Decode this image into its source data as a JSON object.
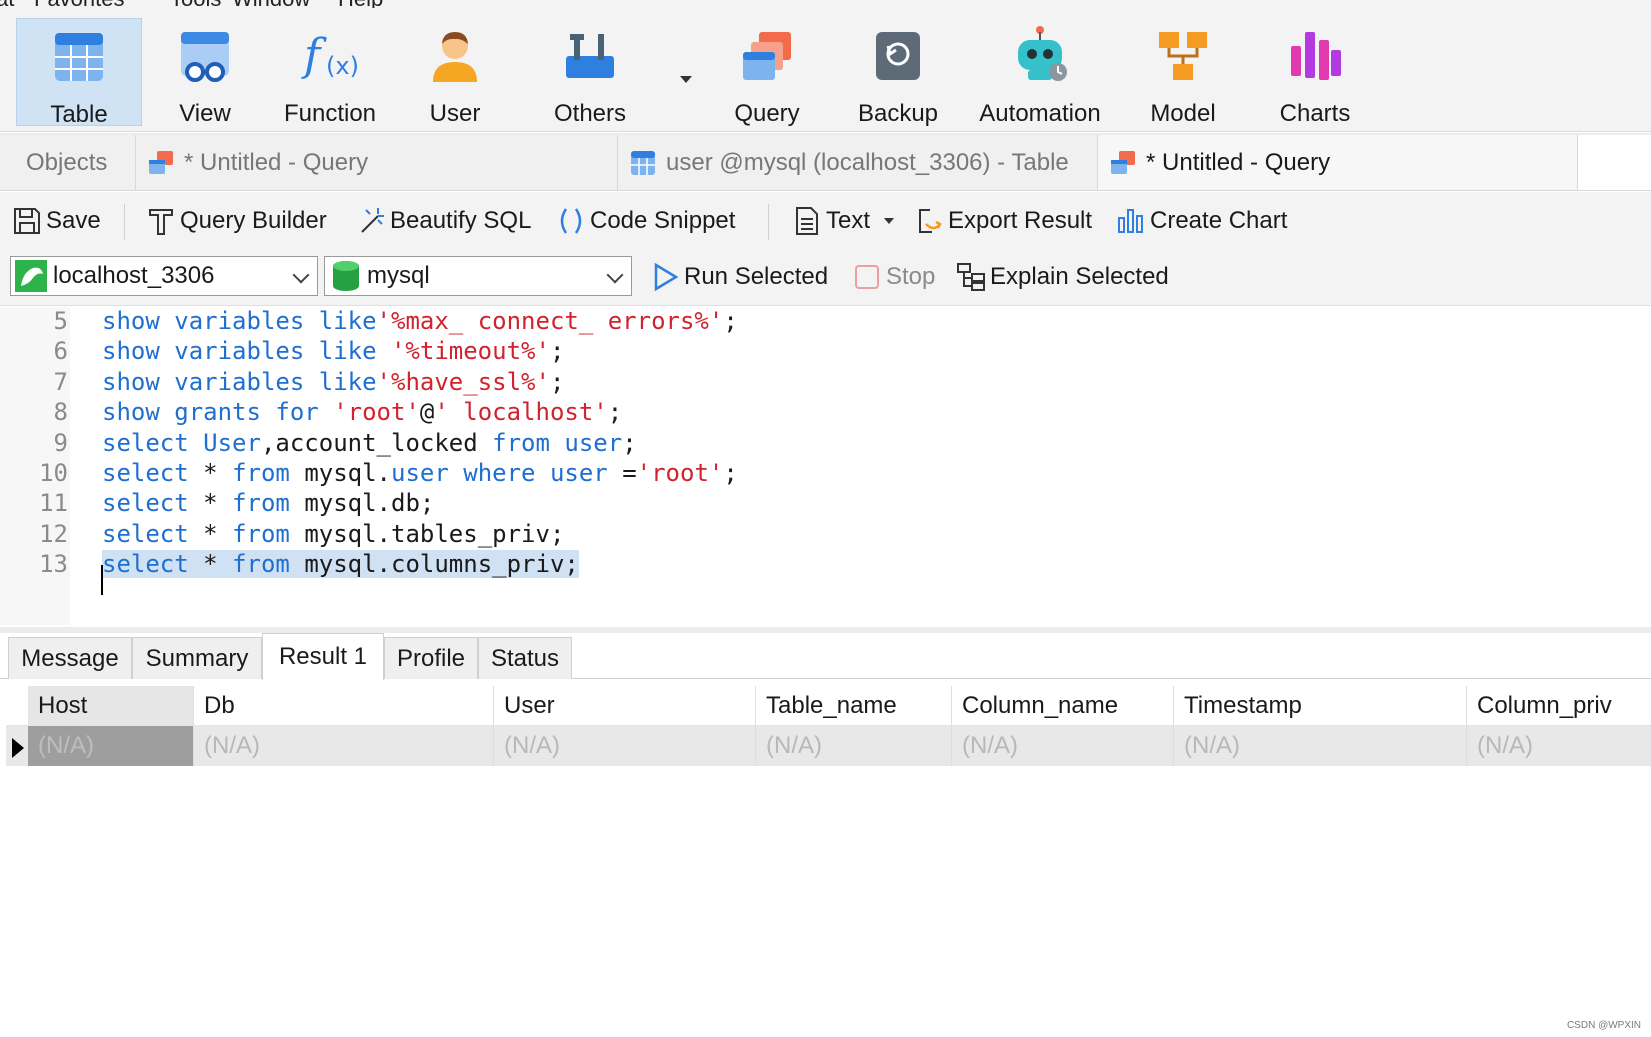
{
  "menu": {
    "items": [
      "at",
      "Favorites",
      "Tools",
      "Window",
      "Help"
    ]
  },
  "toolbar": {
    "buttons": [
      {
        "label": "Table",
        "icon": "table-icon"
      },
      {
        "label": "View",
        "icon": "view-icon"
      },
      {
        "label": "Function",
        "icon": "function-icon"
      },
      {
        "label": "User",
        "icon": "user-icon"
      },
      {
        "label": "Others",
        "icon": "others-icon"
      },
      {
        "label": "Query",
        "icon": "query-icon"
      },
      {
        "label": "Backup",
        "icon": "backup-icon"
      },
      {
        "label": "Automation",
        "icon": "automation-icon"
      },
      {
        "label": "Model",
        "icon": "model-icon"
      },
      {
        "label": "Charts",
        "icon": "charts-icon"
      }
    ],
    "active": "Table"
  },
  "tabs": [
    {
      "label": "Objects"
    },
    {
      "label": "* Untitled - Query"
    },
    {
      "label": "user @mysql (localhost_3306) - Table"
    },
    {
      "label": "* Untitled - Query"
    }
  ],
  "query_toolbar": {
    "save": "Save",
    "query_builder": "Query Builder",
    "beautify": "Beautify SQL",
    "snippet": "Code Snippet",
    "text": "Text",
    "export": "Export Result",
    "create_chart": "Create Chart"
  },
  "connection": {
    "server": "localhost_3306",
    "database": "mysql",
    "run_selected": "Run Selected",
    "stop": "Stop",
    "explain": "Explain Selected"
  },
  "editor": {
    "lines": [
      {
        "n": "5",
        "tokens": [
          [
            "kw",
            "show variables like"
          ],
          [
            "str",
            "'%max_ connect_ errors%'"
          ],
          [
            "pl",
            ";"
          ]
        ]
      },
      {
        "n": "6",
        "tokens": [
          [
            "kw",
            "show variables like "
          ],
          [
            "str",
            "'%timeout%'"
          ],
          [
            "pl",
            ";"
          ]
        ]
      },
      {
        "n": "7",
        "tokens": [
          [
            "kw",
            "show variables like"
          ],
          [
            "str",
            "'%have_ssl%'"
          ],
          [
            "pl",
            ";"
          ]
        ]
      },
      {
        "n": "8",
        "tokens": [
          [
            "kw",
            "show grants for "
          ],
          [
            "str",
            "'root'"
          ],
          [
            "pl",
            "@"
          ],
          [
            "str",
            "' localhost'"
          ],
          [
            "pl",
            ";"
          ]
        ]
      },
      {
        "n": "9",
        "tokens": [
          [
            "kw",
            "select User"
          ],
          [
            "pl",
            ",account_locked "
          ],
          [
            "kw",
            "from user"
          ],
          [
            "pl",
            ";"
          ]
        ]
      },
      {
        "n": "10",
        "tokens": [
          [
            "kw",
            "select "
          ],
          [
            "pl",
            "* "
          ],
          [
            "kw",
            "from "
          ],
          [
            "pl",
            "mysql."
          ],
          [
            "kw",
            "user where user "
          ],
          [
            "pl",
            "="
          ],
          [
            "str",
            "'root'"
          ],
          [
            "pl",
            ";"
          ]
        ]
      },
      {
        "n": "11",
        "tokens": [
          [
            "kw",
            "select "
          ],
          [
            "pl",
            "* "
          ],
          [
            "kw",
            "from "
          ],
          [
            "pl",
            "mysql.db;"
          ]
        ]
      },
      {
        "n": "12",
        "tokens": [
          [
            "kw",
            "select "
          ],
          [
            "pl",
            "* "
          ],
          [
            "kw",
            "from "
          ],
          [
            "pl",
            "mysql.tables_priv;"
          ]
        ]
      },
      {
        "n": "13",
        "tokens": [
          [
            "kw",
            "select "
          ],
          [
            "pl",
            "* "
          ],
          [
            "kw",
            "from "
          ],
          [
            "pl",
            "mysql.columns_priv;"
          ]
        ]
      }
    ]
  },
  "result_tabs": [
    "Message",
    "Summary",
    "Result 1",
    "Profile",
    "Status"
  ],
  "active_result_tab": "Result 1",
  "grid": {
    "columns": [
      "Host",
      "Db",
      "User",
      "Table_name",
      "Column_name",
      "Timestamp",
      "Column_priv"
    ],
    "rows": [
      [
        "(N/A)",
        "(N/A)",
        "(N/A)",
        "(N/A)",
        "(N/A)",
        "(N/A)",
        "(N/A)"
      ]
    ]
  },
  "watermark": "CSDN @WPXIN"
}
